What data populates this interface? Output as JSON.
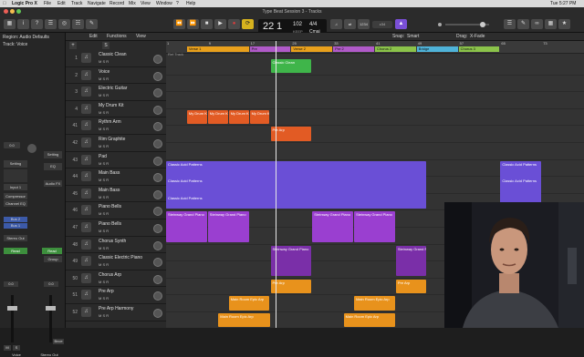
{
  "menubar": {
    "app": "Logic Pro X",
    "items": [
      "File",
      "Edit",
      "Track",
      "Navigate",
      "Record",
      "Mix",
      "View",
      "Window",
      "?",
      "Help"
    ],
    "clock": "Tue 5:27 PM"
  },
  "window": {
    "title": "Type Beat Session 3 - Tracks"
  },
  "transport": {
    "bar": "22",
    "beat": "1",
    "tempo": "102",
    "tempo_label": "KEEP",
    "signature": "4/4",
    "key": "Cmaj",
    "cpu": "c34"
  },
  "toolbar": {
    "edit": "Edit",
    "functions": "Functions",
    "view": "View",
    "snap_label": "Snap:",
    "snap_value": "Smart",
    "drag_label": "Drag:",
    "drag_value": "X-Fade"
  },
  "inspector": {
    "region_label": "Region: Audio Defaults",
    "track_label": "Track: Voice",
    "settings": "Setting",
    "eq": "EQ",
    "input": "Input 1",
    "compressor": "Compressor",
    "channel_eq": "Channel EQ",
    "audio_fx": "Audio FX",
    "bus1": "Bus 2",
    "bus2": "Bus 1",
    "output": "Stereo Out",
    "read": "Read",
    "group": "Group",
    "value_a": "0.0",
    "value_b": "0.0",
    "mute_a": "M",
    "solo_a": "S",
    "name_a": "Voice",
    "name_b": "Stereo Out",
    "bnce": "Bnce"
  },
  "tracks": [
    {
      "num": "1",
      "name": "Classic Clean",
      "icon": "amp-icon"
    },
    {
      "num": "2",
      "name": "Voice",
      "icon": "mic-icon"
    },
    {
      "num": "3",
      "name": "Electric Guitar",
      "icon": "guitar-icon"
    },
    {
      "num": "4",
      "name": "My Drum Kit",
      "icon": "drum-icon"
    },
    {
      "num": "41",
      "name": "Rythm Arm",
      "icon": "keys-icon"
    },
    {
      "num": "42",
      "name": "Rim Graphite",
      "icon": "keys-icon"
    },
    {
      "num": "43",
      "name": "Pad",
      "icon": "keys-icon"
    },
    {
      "num": "44",
      "name": "Main Bass",
      "icon": "keys-icon"
    },
    {
      "num": "45",
      "name": "Main Bass",
      "icon": "keys-icon"
    },
    {
      "num": "46",
      "name": "Piano Bells",
      "icon": "keys-icon"
    },
    {
      "num": "47",
      "name": "Piano Bells",
      "icon": "keys-icon"
    },
    {
      "num": "48",
      "name": "Chorus Synth",
      "icon": "keys-icon"
    },
    {
      "num": "49",
      "name": "Classic Electric Piano",
      "icon": "keys-icon"
    },
    {
      "num": "50",
      "name": "Chorus Arp",
      "icon": "keys-icon"
    },
    {
      "num": "51",
      "name": "Pre Arp",
      "icon": "keys-icon"
    },
    {
      "num": "52",
      "name": "Pre Arp Harmony",
      "icon": "keys-icon"
    }
  ],
  "track_buttons": "M S R",
  "ref_track": "Ref Track",
  "ruler": {
    "bars": [
      "1",
      "9",
      "17",
      "25",
      "33",
      "41",
      "49",
      "57",
      "65",
      "73"
    ],
    "markers": [
      {
        "label": "Verse 1",
        "color": "#e8a01c"
      },
      {
        "label": "Pre",
        "color": "#b05ac8"
      },
      {
        "label": "Verse 2",
        "color": "#e8a01c"
      },
      {
        "label": "Pre 2",
        "color": "#b05ac8"
      },
      {
        "label": "Chorus 2",
        "color": "#8bc34a"
      },
      {
        "label": "Bridge",
        "color": "#4fb3d9"
      },
      {
        "label": "Chorus 3",
        "color": "#8bc34a"
      }
    ]
  },
  "regions": [
    {
      "lane": 1,
      "label": "Classic Clean",
      "color": "#3fb54a"
    },
    {
      "lane": 4,
      "label": "My Drum Kit",
      "color": "#e25b24"
    },
    {
      "lane": 4,
      "label": "My Drum Kit",
      "color": "#e25b24"
    },
    {
      "lane": 4,
      "label": "My Drum Kit",
      "color": "#e25b24"
    },
    {
      "lane": 4,
      "label": "My Drum Kit",
      "color": "#e25b24"
    },
    {
      "lane": 5,
      "label": "Pre Arp",
      "color": "#e25b24"
    },
    {
      "lane": 7,
      "label": "Classic Acid Patterns",
      "color": "#6a4fd6"
    },
    {
      "lane": 7,
      "label": "Classic Acid Patterns",
      "color": "#6a4fd6"
    },
    {
      "lane": 8,
      "label": "Classic Acid Patterns",
      "color": "#6a4fd6"
    },
    {
      "lane": 8,
      "label": "Classic Acid Patterns",
      "color": "#6a4fd6"
    },
    {
      "lane": 9,
      "label": "Classic Acid Patterns",
      "color": "#6a4fd6"
    },
    {
      "lane": 10,
      "label": "Steinway Grand Piano",
      "color": "#9a3fd0"
    },
    {
      "lane": 10,
      "label": "Steinway Grand Piano",
      "color": "#9a3fd0"
    },
    {
      "lane": 10,
      "label": "Steinway Grand Piano",
      "color": "#9a3fd0"
    },
    {
      "lane": 10,
      "label": "Steinway Grand Piano",
      "color": "#9a3fd0"
    },
    {
      "lane": 12,
      "label": "Steinway Grand Piano",
      "color": "#7a2fa8"
    },
    {
      "lane": 12,
      "label": "Steinway Grand Piano",
      "color": "#7a2fa8"
    },
    {
      "lane": 14,
      "label": "Pre Arp",
      "color": "#e8921c"
    },
    {
      "lane": 14,
      "label": "Pre Arp",
      "color": "#e8921c"
    },
    {
      "lane": 15,
      "label": "Main Room Epic Arp",
      "color": "#e8921c"
    },
    {
      "lane": 15,
      "label": "Main Room Epic Arp",
      "color": "#e8921c"
    },
    {
      "lane": 15,
      "label": "Main Room Epic Arp",
      "color": "#e8921c"
    },
    {
      "lane": 16,
      "label": "Main Room Epic Arp",
      "color": "#e8921c"
    },
    {
      "lane": 16,
      "label": "Main Room Epic Arp",
      "color": "#e8921c"
    }
  ],
  "colors": {
    "accent": "#7a4fd6",
    "playhead": "#e8e8e8",
    "record": "#e03c3c"
  }
}
